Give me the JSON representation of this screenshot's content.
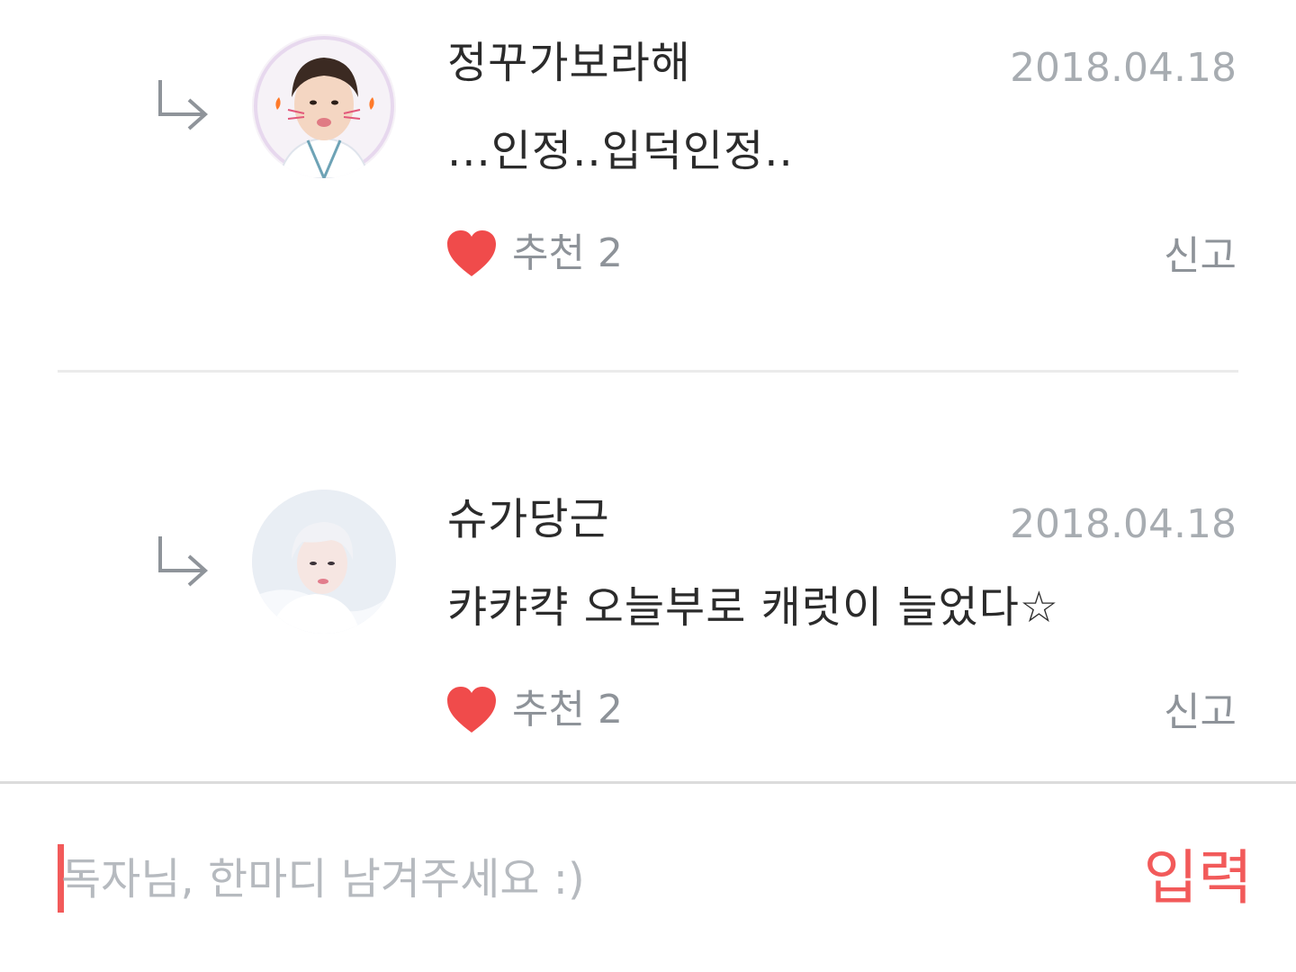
{
  "comments": [
    {
      "username": "정꾸가보라해",
      "date": "2018.04.18",
      "text": "...인정..입덕인정..",
      "like_label": "추천",
      "like_count": "2",
      "report_label": "신고",
      "avatar": "avatar-1"
    },
    {
      "username": "슈가당근",
      "date": "2018.04.18",
      "text": "캬캬캭 오늘부로 캐럿이 늘었다☆",
      "like_label": "추천",
      "like_count": "2",
      "report_label": "신고",
      "avatar": "avatar-2"
    }
  ],
  "input": {
    "placeholder": "독자님, 한마디 남겨주세요 :)",
    "submit_label": "입력"
  },
  "colors": {
    "accent": "#f25a5a",
    "heart": "#f04b4b",
    "muted_text": "#8e9399",
    "date_text": "#a7acb1"
  },
  "icons": {
    "reply": "reply-arrow-icon",
    "like": "heart-icon"
  }
}
